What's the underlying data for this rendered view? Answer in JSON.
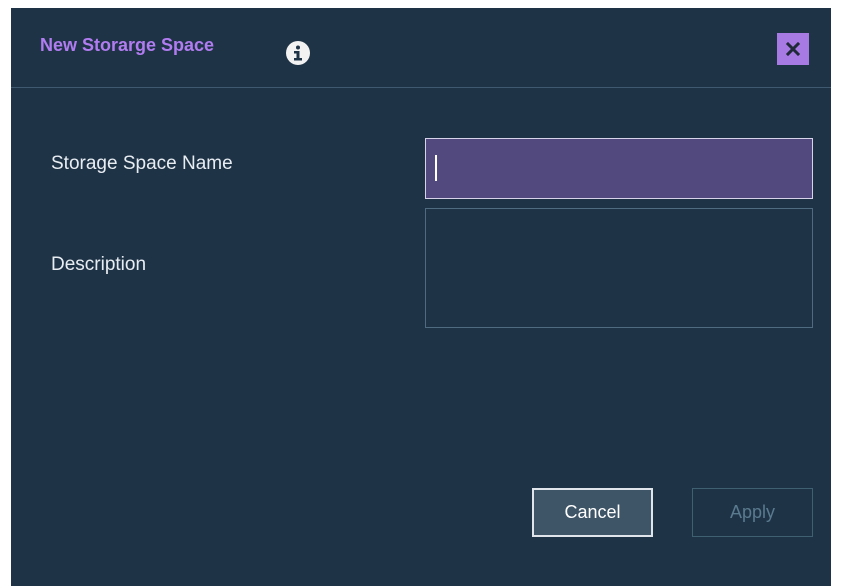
{
  "dialog": {
    "title": "New Storarge Space",
    "info_icon": "info-icon",
    "close_icon": "close-icon",
    "close_glyph": "✕"
  },
  "form": {
    "name_label": "Storage Space Name",
    "name_value": "",
    "description_label": "Description",
    "description_value": ""
  },
  "buttons": {
    "cancel_label": "Cancel",
    "apply_label": "Apply"
  },
  "colors": {
    "dialog_bg": "#1f3347",
    "title": "#b07cf0",
    "close_bg": "#a779e3",
    "active_input_bg": "#524a7e"
  }
}
